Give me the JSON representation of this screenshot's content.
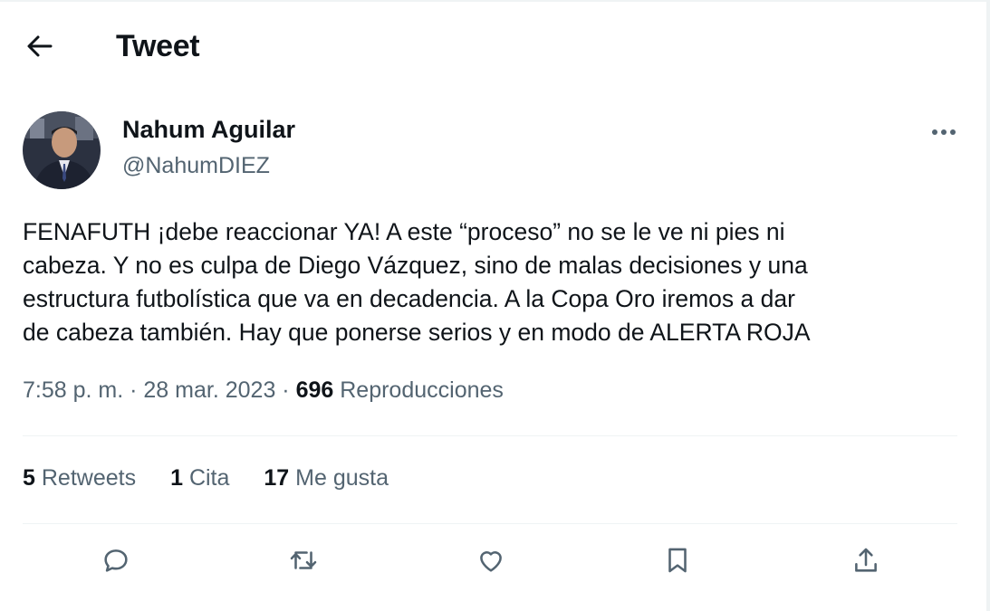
{
  "header": {
    "title": "Tweet",
    "back_icon": "arrow-left-icon"
  },
  "author": {
    "name": "Nahum Aguilar",
    "handle": "@NahumDIEZ"
  },
  "tweet": {
    "lines": [
      "FENAFUTH ¡debe reaccionar YA! A este “proceso” no se le ve ni pies ni",
      "cabeza. Y no es culpa de Diego Vázquez, sino de malas decisiones y una",
      "estructura futbolística que va en decadencia. A la Copa Oro iremos a dar",
      "de cabeza también. Hay que ponerse serios y en modo de ALERTA ROJA"
    ]
  },
  "meta": {
    "time": "7:58 p. m.",
    "separator": "·",
    "date": "28 mar. 2023",
    "views_count": "696",
    "views_label": "Reproducciones"
  },
  "stats": {
    "retweets_count": "5",
    "retweets_label": "Retweets",
    "quotes_count": "1",
    "quotes_label": "Cita",
    "likes_count": "17",
    "likes_label": "Me gusta"
  },
  "actions": [
    "reply-icon",
    "retweet-icon",
    "like-icon",
    "bookmark-icon",
    "share-icon"
  ],
  "colors": {
    "text": "#0f1419",
    "secondary": "#536471",
    "divider": "#eff3f4"
  }
}
